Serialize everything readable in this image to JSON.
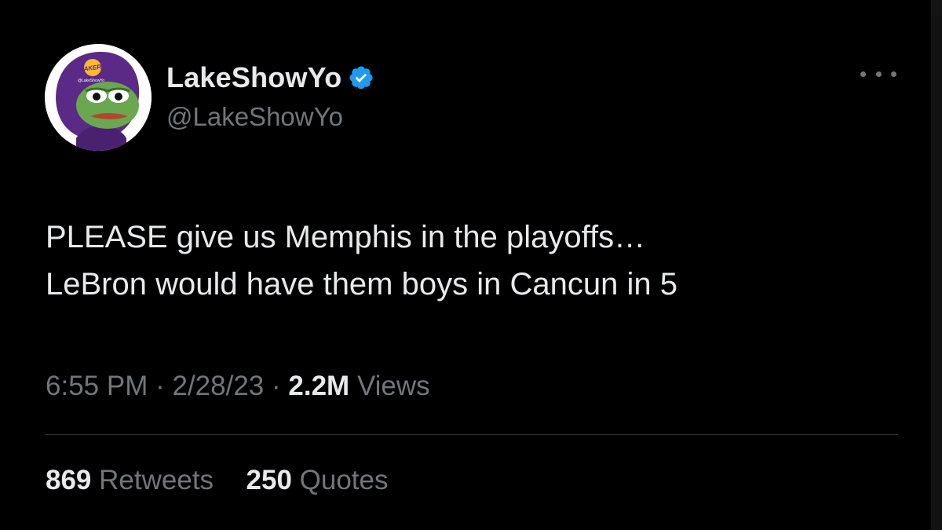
{
  "colors": {
    "background": "#000000",
    "text_primary": "#e7e9ea",
    "text_secondary": "#71767b",
    "verified_blue": "#1d9bf0",
    "divider": "#2f3336",
    "avatar_purple": "#5b2a86",
    "avatar_gold": "#fdb927"
  },
  "author": {
    "display_name": "LakeShowYo",
    "handle": "@LakeShowYo",
    "verified": true,
    "avatar_icon": "pepe-lakers-hoodie-avatar",
    "avatar_logo_text": "LAKERS",
    "avatar_small_text": "@LakeShowYo"
  },
  "tweet": {
    "text_lines": [
      "PLEASE give us Memphis in the playoffs…",
      "LeBron would have them boys in Cancun in 5"
    ],
    "time": "6:55 PM",
    "date": "2/28/23",
    "views_count": "2.2M",
    "views_label": "Views",
    "separator": "·"
  },
  "stats": {
    "retweets_count": "869",
    "retweets_label": "Retweets",
    "quotes_count": "250",
    "quotes_label": "Quotes"
  },
  "icons": {
    "verified": "verified-badge-icon",
    "more": "more-options-icon"
  }
}
